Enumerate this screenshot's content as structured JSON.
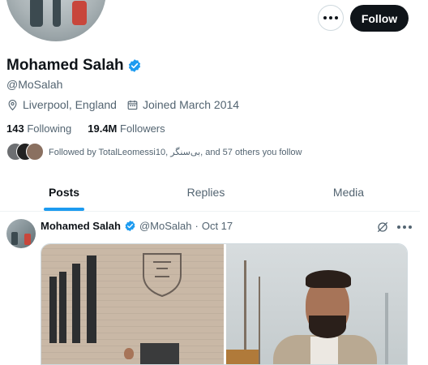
{
  "header": {
    "follow_label": "Follow"
  },
  "profile": {
    "name": "Mohamed Salah",
    "handle": "@MoSalah",
    "location": "Liverpool, England",
    "joined": "Joined March 2014",
    "following_count": "143",
    "following_label": "Following",
    "followers_count": "19.4M",
    "followers_label": "Followers",
    "followed_by": "Followed by TotalLeomessi10, بی‌سنگر, and 57 others you follow"
  },
  "tabs": [
    {
      "label": "Posts",
      "active": true
    },
    {
      "label": "Replies",
      "active": false
    },
    {
      "label": "Media",
      "active": false
    }
  ],
  "post": {
    "author": "Mohamed Salah",
    "handle": "@MoSalah",
    "separator": "·",
    "date": "Oct 17"
  },
  "colors": {
    "accent": "#1d9bf0",
    "text_primary": "#0f1419",
    "text_secondary": "#536471",
    "verified": "#1d9bf0"
  },
  "icons": [
    "more-icon",
    "verified-badge-icon",
    "location-icon",
    "calendar-icon",
    "grok-icon"
  ]
}
